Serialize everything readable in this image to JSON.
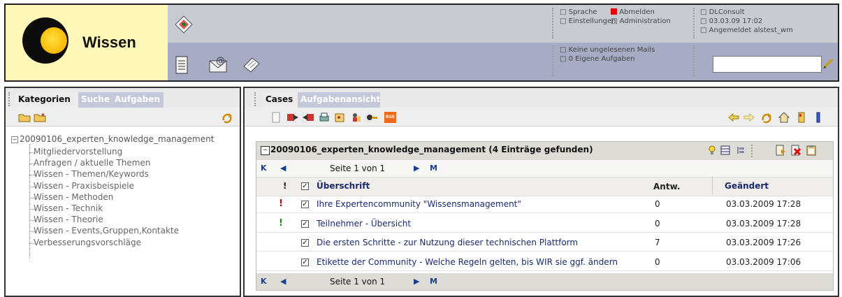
{
  "app": {
    "logo_text": "Wissen"
  },
  "header": {
    "menu": {
      "sprache": "Sprache",
      "abmelden": "Abmelden",
      "einstellungen": "Einstellungen",
      "administration": "Administration"
    },
    "user": {
      "org": "DLConsult",
      "datetime": "03.03.09 17:02",
      "logged_in": "Angemeldet alstest_wm"
    },
    "notices": {
      "mails": "Keine ungelesenen Mails",
      "tasks": "0 Eigene Aufgaben"
    },
    "search": {
      "value": ""
    }
  },
  "left": {
    "tabs": [
      "Kategorien",
      "Suche",
      "Aufgaben"
    ],
    "root": "20090106_experten_knowledge_management",
    "items": [
      "Mitgliedervorstellung",
      "Anfragen / aktuelle Themen",
      "Wissen - Themen/Keywords",
      "Wissen - Praxisbeispiele",
      "Wissen - Methoden",
      "Wissen - Technik",
      "Wissen - Theorie",
      "Wissen - Events,Gruppen,Kontakte",
      "Verbesserungsvorschläge"
    ]
  },
  "right": {
    "tabs": [
      "Cases",
      "Aufgabenansicht"
    ],
    "rss": "RSS",
    "title": "20090106_experten_knowledge_management (4 Einträge gefunden)",
    "pager_top": "Seite 1 von 1",
    "pager_bottom": "Seite 1 von 1",
    "columns": {
      "priority": "!",
      "title": "Überschrift",
      "answers": "Antw.",
      "changed": "Geändert"
    },
    "rows": [
      {
        "priority": "!",
        "priority_color": "#d40000",
        "title": "Ihre Expertencommunity \"Wissensmanagement\"",
        "answers": "0",
        "changed": "03.03.2009 17:28"
      },
      {
        "priority": "!",
        "priority_color": "#1a8a1a",
        "title": "Teilnehmer - Übersicht",
        "answers": "0",
        "changed": "03.03.2009 17:28"
      },
      {
        "priority": "",
        "priority_color": "",
        "title": "Die ersten Schritte - zur Nutzung dieser technischen Plattform",
        "answers": "7",
        "changed": "03.03.2009 17:26"
      },
      {
        "priority": "",
        "priority_color": "",
        "title": "Etikette der Community - Welche Regeln gelten, bis WIR sie ggf. ändern",
        "answers": "0",
        "changed": "03.03.2009 17:06"
      }
    ]
  },
  "colors": {
    "logo_bg": "#fff8b8",
    "header_top": "#c9cbd3",
    "header_bottom": "#a7abc3",
    "tab_inactive": "#c4c8d8",
    "link": "#1a2a6a",
    "logout_red": "#e00000"
  }
}
